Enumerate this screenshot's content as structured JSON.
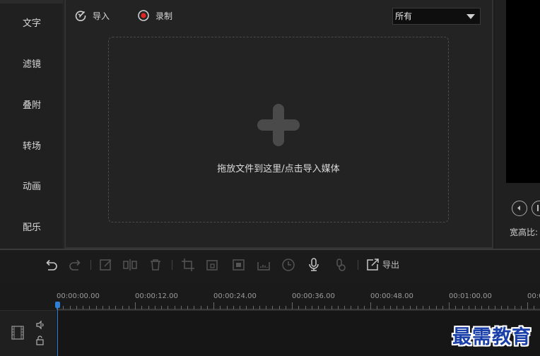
{
  "sidebar": {
    "items": [
      {
        "label": "文字"
      },
      {
        "label": "滤镜"
      },
      {
        "label": "叠附"
      },
      {
        "label": "转场"
      },
      {
        "label": "动画"
      },
      {
        "label": "配乐"
      }
    ]
  },
  "media_panel": {
    "import_tab": "导入",
    "record_tab": "录制",
    "filter_selected": "所有",
    "drop_hint": "拖放文件到这里/点击导入媒体"
  },
  "preview": {
    "aspect_label": "宽高比:"
  },
  "toolbar": {
    "export_label": "导出"
  },
  "timeline": {
    "ruler_labels": [
      "00:00:00.00",
      "00:00:12.00",
      "00:00:24.00",
      "00:00:36.00",
      "00:00:48.00",
      "00:01:00.00",
      "00:0"
    ]
  },
  "watermark": "最需教育",
  "colors": {
    "accent_blue": "#2e7fd8",
    "record_red": "#e02424",
    "watermark_blue": "#1a3fa8"
  }
}
